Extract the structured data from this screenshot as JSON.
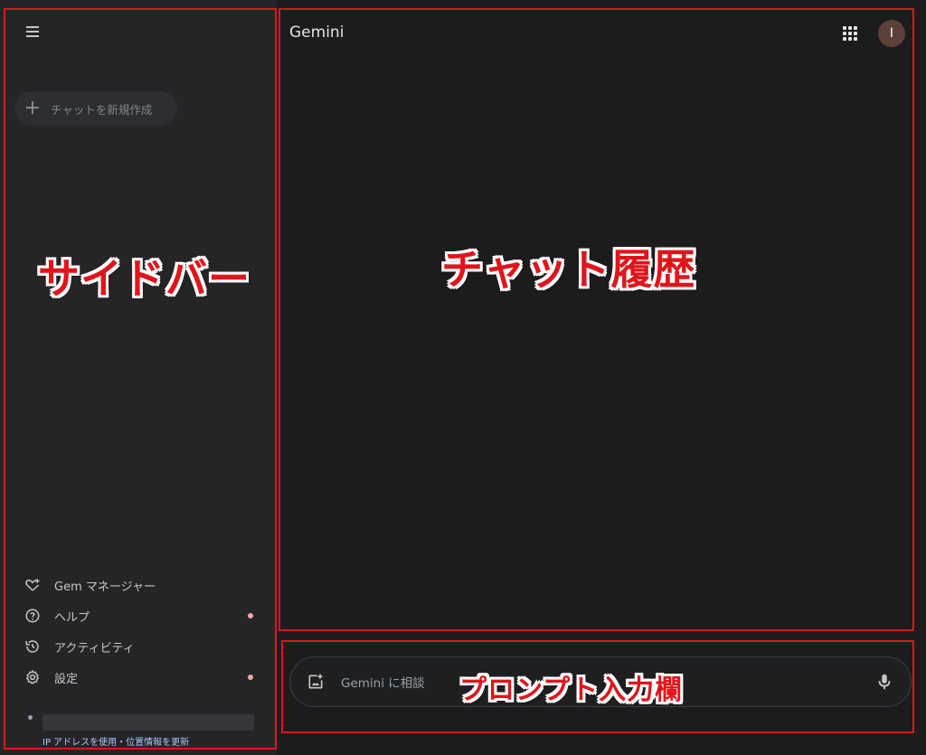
{
  "sidebar": {
    "new_chat_label": "チャットを新規作成",
    "items": [
      {
        "label": "Gem マネージャー",
        "icon": "gem-heart-icon",
        "dot": false
      },
      {
        "label": "ヘルプ",
        "icon": "help-circle-icon",
        "dot": true
      },
      {
        "label": "アクティビティ",
        "icon": "history-icon",
        "dot": false
      },
      {
        "label": "設定",
        "icon": "gear-icon",
        "dot": true
      }
    ],
    "location_link": "IP アドレスを使用・位置情報を更新"
  },
  "header": {
    "title": "Gemini",
    "avatar_initial": "I"
  },
  "prompt": {
    "placeholder": "Gemini に相談"
  },
  "annotations": {
    "sidebar_label": "サイドバー",
    "chat_history_label": "チャット履歴",
    "prompt_label": "プロンプト入力欄"
  },
  "colors": {
    "annotation_red": "#e0151b",
    "notification_dot": "#f2a9a0",
    "link_blue": "#a8c7fa",
    "avatar_bg": "#5d4037"
  }
}
